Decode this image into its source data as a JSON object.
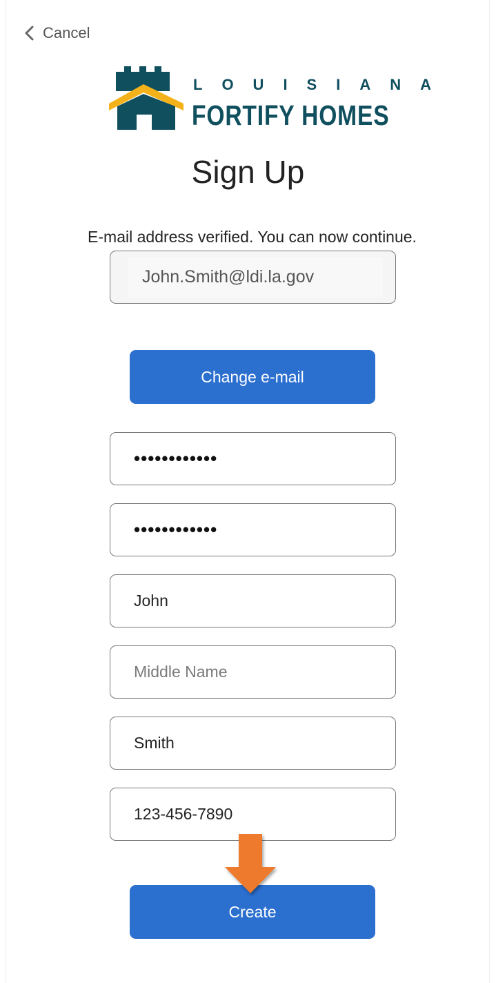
{
  "header": {
    "cancel_label": "Cancel"
  },
  "logo": {
    "line1": "LOUISIANA",
    "line2": "FORTIFY HOMES",
    "colors": {
      "teal": "#0f4f5e",
      "gold": "#f4b21a"
    }
  },
  "page_title": "Sign Up",
  "status_message": "E-mail address verified. You can now continue.",
  "form": {
    "email_value": "John.Smith@ldi.la.gov",
    "change_email_label": "Change e-mail",
    "password_mask": "••••••••••••",
    "confirm_password_mask": "••••••••••••",
    "first_name_value": "John",
    "middle_name_placeholder": "Middle Name",
    "last_name_value": "Smith",
    "phone_value": "123-456-7890",
    "create_label": "Create"
  },
  "colors": {
    "button_blue": "#2b6fcf",
    "arrow_orange": "#ee7a2e"
  },
  "annotations": {
    "arrow_icon": "orange-down-arrow"
  }
}
